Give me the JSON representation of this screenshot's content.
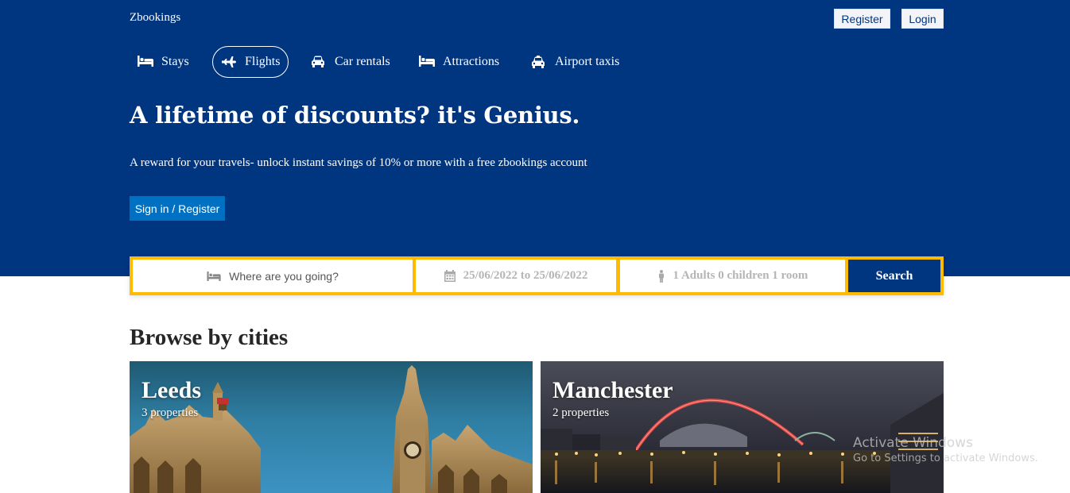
{
  "brand": {
    "name": "Zbookings"
  },
  "header": {
    "register_label": "Register",
    "login_label": "Login"
  },
  "nav": {
    "items": [
      {
        "label": "Stays",
        "icon": "bed-icon"
      },
      {
        "label": "Flights",
        "icon": "plane-icon",
        "active": true
      },
      {
        "label": "Car rentals",
        "icon": "car-icon"
      },
      {
        "label": "Attractions",
        "icon": "bed-icon"
      },
      {
        "label": "Airport taxis",
        "icon": "taxi-icon"
      }
    ]
  },
  "hero": {
    "title": "A lifetime of discounts? it's Genius.",
    "subtitle": "A reward for your travels- unlock instant savings of 10% or more with a free zbookings account",
    "cta_label": "Sign in / Register"
  },
  "search": {
    "destination_placeholder": "Where are you going?",
    "dates_value": "25/06/2022 to 25/06/2022",
    "guests_value": "1 Adults 0 children 1 room",
    "button_label": "Search"
  },
  "browse": {
    "title": "Browse by cities",
    "cities": [
      {
        "name": "Leeds",
        "properties": "3 properties"
      },
      {
        "name": "Manchester",
        "properties": "2 properties"
      }
    ]
  },
  "watermark": {
    "title": "Activate Windows",
    "subtitle": "Go to Settings to activate Windows."
  },
  "colors": {
    "primary": "#003580",
    "accent": "#febb02",
    "cta": "#0071c2"
  }
}
